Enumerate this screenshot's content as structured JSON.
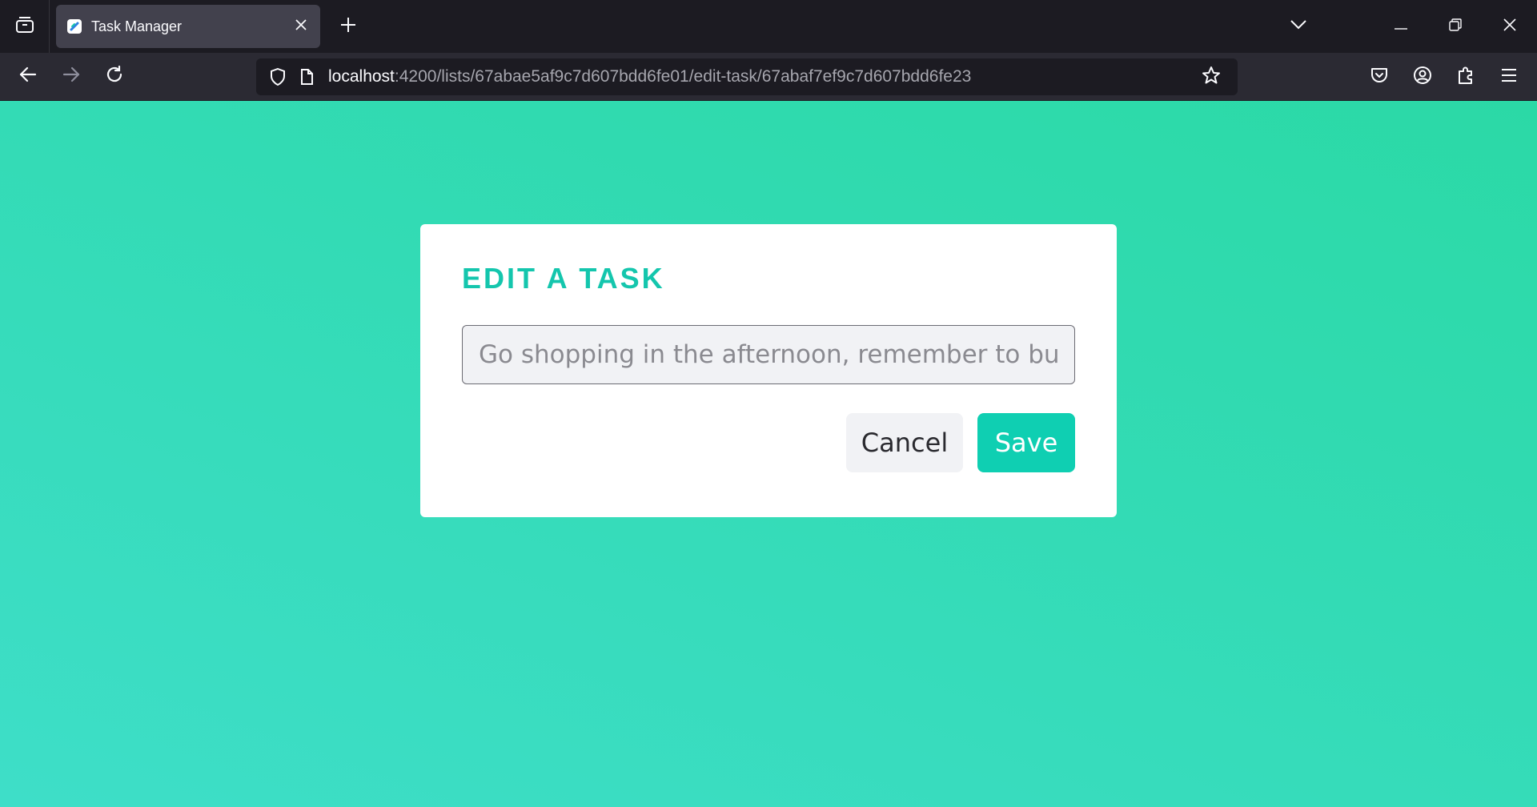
{
  "browser": {
    "tab": {
      "title": "Task Manager"
    },
    "url": {
      "host": "localhost",
      "path": ":4200/lists/67abae5af9c7d607bdd6fe01/edit-task/67abaf7ef9c7d607bdd6fe23"
    },
    "icons": {
      "tab_overview": "tab-overview-icon",
      "favicon": "app-favicon-icon",
      "close_tab": "close-icon",
      "new_tab": "plus-icon",
      "list_tabs": "chevron-down-icon",
      "minimize": "minimize-icon",
      "restore": "restore-icon",
      "close_window": "close-icon",
      "back": "arrow-left-icon",
      "forward": "arrow-right-icon",
      "reload": "reload-icon",
      "shield": "shield-icon",
      "page": "page-icon",
      "bookmark": "star-icon",
      "pocket": "pocket-icon",
      "account": "account-icon",
      "extensions": "puzzle-icon",
      "menu": "hamburger-menu-icon"
    }
  },
  "modal": {
    "title": "EDIT A TASK",
    "task_input": {
      "value": "",
      "placeholder": "Go shopping in the afternoon, remember to buy garde"
    },
    "cancel_label": "Cancel",
    "save_label": "Save"
  },
  "colors": {
    "accent": "#14c6ad",
    "save_button": "#0fcfb2",
    "page_bg_start": "#2bd9a6",
    "page_bg_end": "#3edec8"
  }
}
